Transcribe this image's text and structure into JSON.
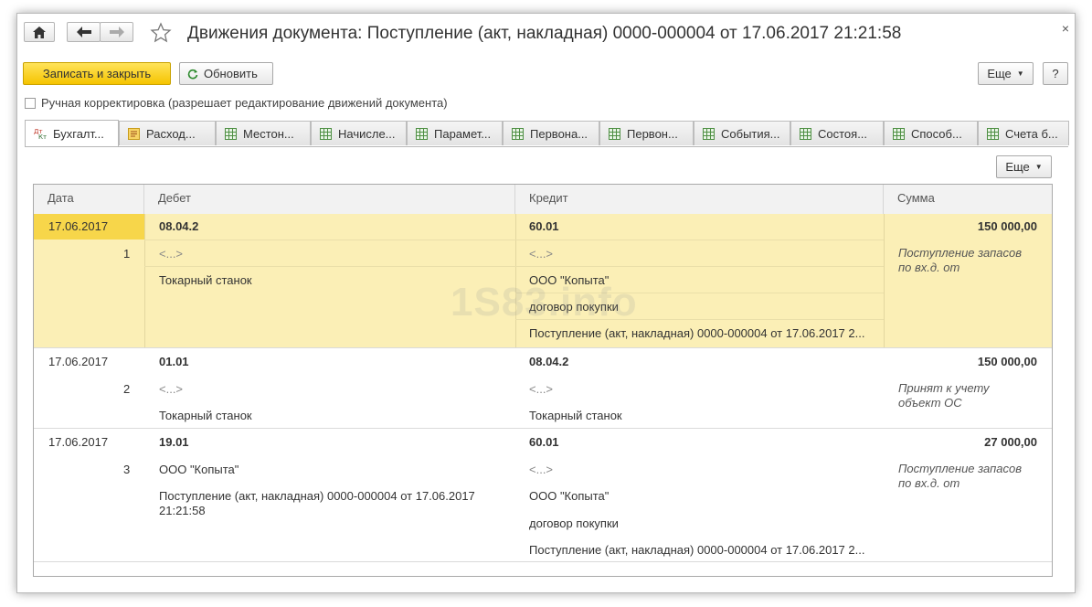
{
  "window": {
    "title": "Движения документа: Поступление (акт, накладная) 0000-000004 от 17.06.2017 21:21:58",
    "close_glyph": "×"
  },
  "toolbar": {
    "save_close_label": "Записать и закрыть",
    "refresh_label": "Обновить",
    "more_label": "Еще",
    "help_label": "?"
  },
  "manual_edit": {
    "label": "Ручная корректировка (разрешает редактирование движений документа)",
    "checked": false
  },
  "tabs": [
    {
      "label": "Бухгалт...",
      "icon": "accounting-icon",
      "active": true
    },
    {
      "label": "Расход...",
      "icon": "register-icon",
      "active": false
    },
    {
      "label": "Местон...",
      "icon": "table-icon",
      "active": false
    },
    {
      "label": "Начисле...",
      "icon": "table-icon",
      "active": false
    },
    {
      "label": "Парамет...",
      "icon": "table-icon",
      "active": false
    },
    {
      "label": "Первона...",
      "icon": "table-icon",
      "active": false
    },
    {
      "label": "Первон...",
      "icon": "table-icon",
      "active": false
    },
    {
      "label": "События...",
      "icon": "table-icon",
      "active": false
    },
    {
      "label": "Состоя...",
      "icon": "table-icon",
      "active": false
    },
    {
      "label": "Способ...",
      "icon": "table-icon",
      "active": false
    },
    {
      "label": "Счета б...",
      "icon": "table-icon",
      "active": false
    }
  ],
  "grid": {
    "more_label": "Еще",
    "columns": [
      "Дата",
      "Дебет",
      "Кредит",
      "Сумма"
    ],
    "rows": [
      {
        "date": "17.06.2017",
        "num": "1",
        "debit": {
          "account": "08.04.2",
          "sub1": "<...>",
          "sub2": "Токарный станок"
        },
        "credit": {
          "account": "60.01",
          "sub1": "<...>",
          "sub2": "ООО \"Копыта\"",
          "sub3": "договор покупки",
          "sub4": "Поступление (акт, накладная) 0000-000004 от 17.06.2017 2..."
        },
        "sum": "150 000,00",
        "content_l1": "Поступление запасов",
        "content_l2": "по вх.д.  от"
      },
      {
        "date": "17.06.2017",
        "num": "2",
        "debit": {
          "account": "01.01",
          "sub1": "<...>",
          "sub2": "Токарный станок"
        },
        "credit": {
          "account": "08.04.2",
          "sub1": "<...>",
          "sub2": "Токарный станок"
        },
        "sum": "150 000,00",
        "content_l1": "Принят к учету",
        "content_l2": "объект ОС"
      },
      {
        "date": "17.06.2017",
        "num": "3",
        "debit": {
          "account": "19.01",
          "sub1": "ООО \"Копыта\"",
          "sub2": "Поступление (акт, накладная) 0000-000004 от 17.06.2017",
          "sub2b": "21:21:58"
        },
        "credit": {
          "account": "60.01",
          "sub1": "<...>",
          "sub2": "ООО \"Копыта\"",
          "sub3": "договор покупки",
          "sub4": "Поступление (акт, накладная) 0000-000004 от 17.06.2017 2..."
        },
        "sum": "27 000,00",
        "content_l1": "Поступление запасов",
        "content_l2": "по вх.д.  от"
      }
    ]
  },
  "watermark": "1S83.info"
}
